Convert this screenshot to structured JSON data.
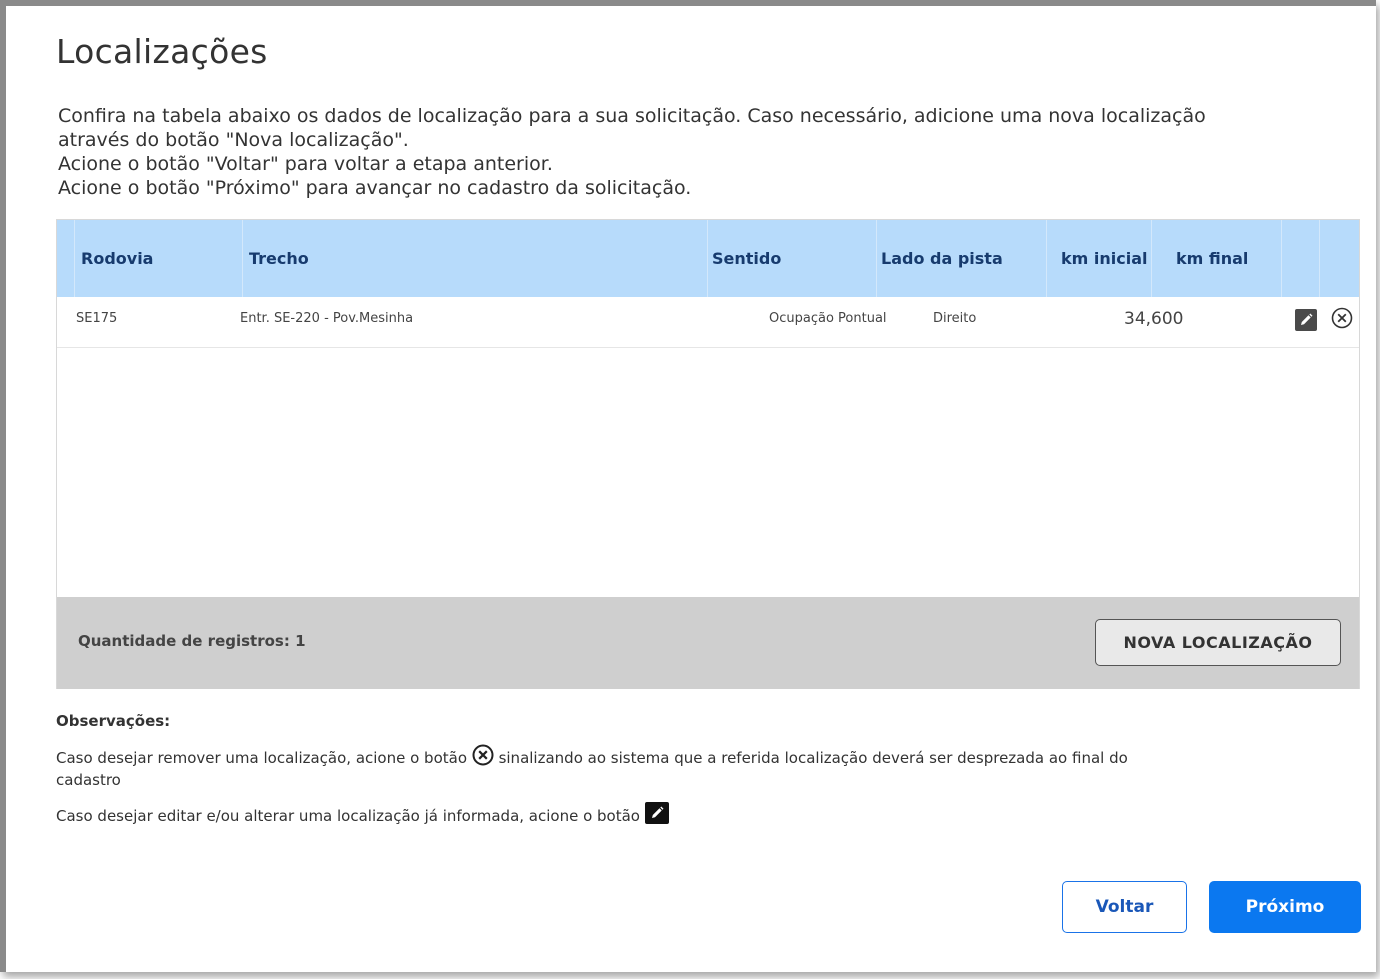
{
  "page": {
    "title": "Localizações",
    "intro_lines": [
      "Confira na tabela abaixo os dados de localização para a sua solicitação. Caso necessário, adicione uma nova localização",
      "através do botão \"Nova localização\".",
      "Acione o botão \"Voltar\" para voltar a etapa anterior.",
      "Acione o botão \"Próximo\" para avançar no cadastro da solicitação."
    ]
  },
  "table": {
    "headers": {
      "rodovia": "Rodovia",
      "trecho": "Trecho",
      "sentido": "Sentido",
      "lado": "Lado da pista",
      "km_inicial": "km inicial",
      "km_final": "km final"
    },
    "rows": [
      {
        "rodovia": "SE175",
        "trecho": "Entr. SE-220 - Pov.Mesinha",
        "sentido": "Ocupação Pontual",
        "lado": "Direito",
        "km": "34,600"
      }
    ],
    "edit_icon": "pencil-icon",
    "remove_icon": "circle-x-icon"
  },
  "footer": {
    "count_label": "Quantidade de registros: 1",
    "nova_button": "NOVA LOCALIZAÇÃO"
  },
  "observacoes": {
    "title": "Observações:",
    "remove_text_before": "Caso desejar remover uma localização, acione o botão",
    "remove_text_after": "sinalizando ao sistema que a referida localização deverá ser desprezada ao final do",
    "remove_text_wrap": "cadastro",
    "edit_text": "Caso desejar editar e/ou alterar uma localização já informada, acione o botão"
  },
  "nav": {
    "voltar": "Voltar",
    "proximo": "Próximo"
  },
  "colors": {
    "header_bg": "#b7dbfb",
    "header_text": "#173b6e",
    "primary": "#0b78f0",
    "footer_bg": "#cfcfcf"
  }
}
